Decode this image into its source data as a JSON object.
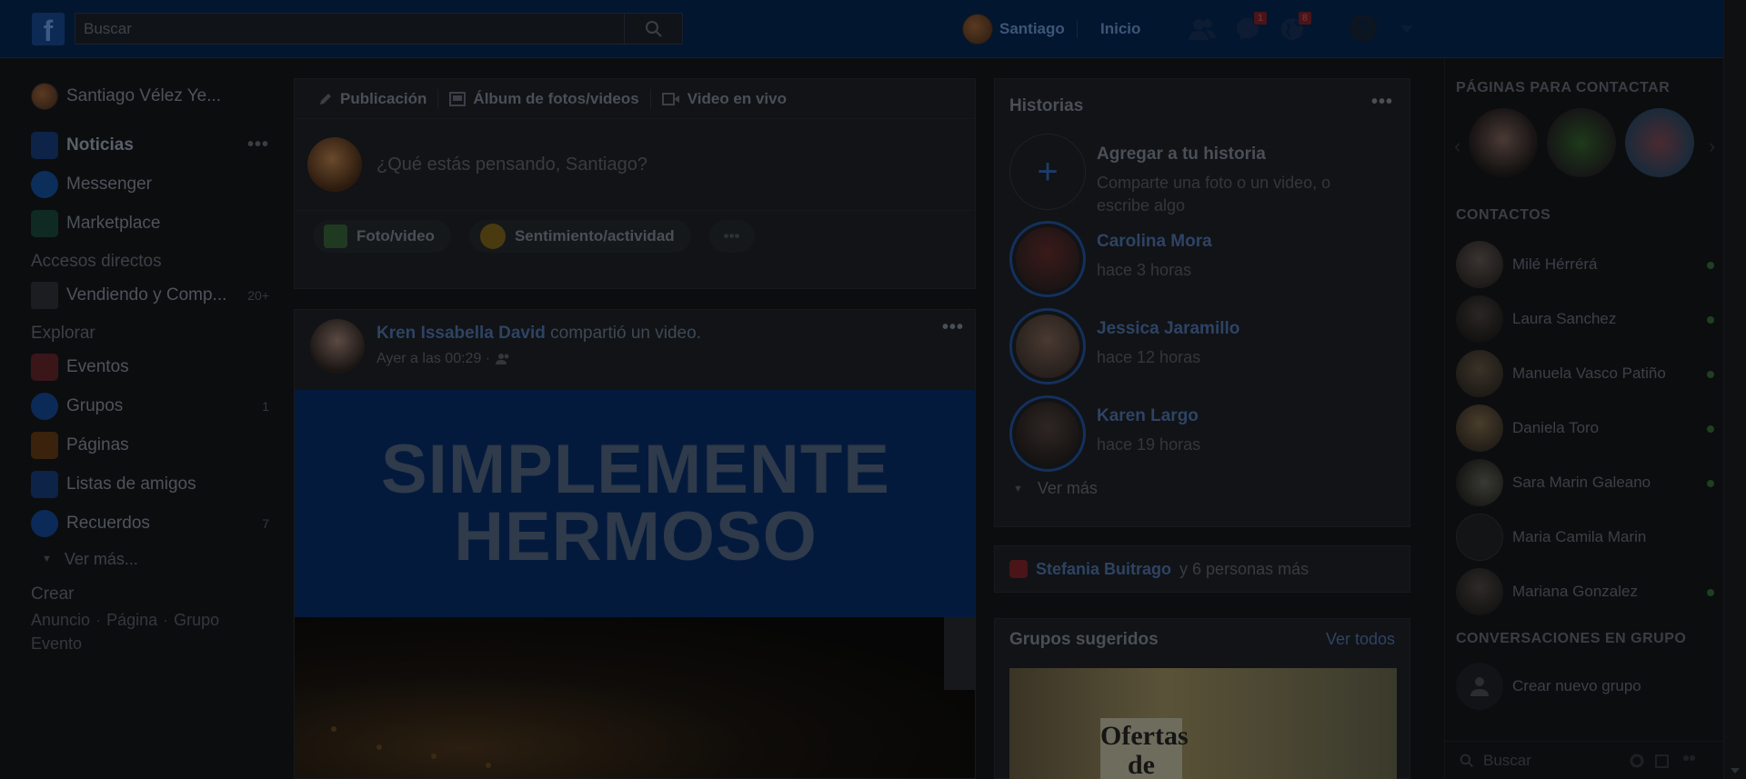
{
  "topbar": {
    "logo": "f",
    "search_placeholder": "Buscar",
    "user_name": "Santiago",
    "home": "Inicio",
    "messages_badge": "1",
    "notifications_badge": "8",
    "help": "?",
    "accent": "#02162f"
  },
  "sidebar": {
    "user": "Santiago Vélez Ye...",
    "news": "Noticias",
    "messenger": "Messenger",
    "marketplace": "Marketplace",
    "shortcuts_title": "Accesos directos",
    "shortcut_item": "Vendiendo y Comp...",
    "shortcut_count": "20+",
    "explore_title": "Explorar",
    "events": "Eventos",
    "groups": "Grupos",
    "groups_count": "1",
    "pages": "Páginas",
    "friend_lists": "Listas de amigos",
    "memories": "Recuerdos",
    "memories_count": "7",
    "see_more": "Ver más...",
    "create_title": "Crear",
    "create_ad": "Anuncio",
    "create_page": "Página",
    "create_group": "Grupo",
    "create_event": "Evento"
  },
  "composer": {
    "tab_post": "Publicación",
    "tab_album": "Álbum de fotos/videos",
    "tab_live": "Video en vivo",
    "placeholder": "¿Qué estás pensando, Santiago?",
    "photo_video": "Foto/video",
    "feeling": "Sentimiento/actividad",
    "more": "•••"
  },
  "post": {
    "author": "Kren Issabella David",
    "action": "compartió un video.",
    "time": "Ayer a las 00:29 ·",
    "banner_line1": "SIMPLEMENTE",
    "banner_line2": "HERMOSO",
    "menu": "•••"
  },
  "stories": {
    "title": "Historias",
    "menu": "•••",
    "add_title": "Agregar a tu historia",
    "add_sub": "Comparte una foto o un video, o escribe algo",
    "items": [
      {
        "name": "Carolina Mora",
        "time": "hace 3 horas"
      },
      {
        "name": "Jessica Jaramillo",
        "time": "hace 12 horas"
      },
      {
        "name": "Karen Largo",
        "time": "hace 19 horas"
      }
    ],
    "see_more": "Ver más"
  },
  "birthday": {
    "name": "Stefania Buitrago",
    "rest": "y 6 personas más"
  },
  "groups_suggest": {
    "title": "Grupos sugeridos",
    "see_all": "Ver todos",
    "image_text": "Ofertas de"
  },
  "right": {
    "pages_title": "PÁGINAS PARA CONTACTAR",
    "contacts_title": "CONTACTOS",
    "contacts": [
      {
        "name": "Milé Hérrérá"
      },
      {
        "name": "Laura Sanchez"
      },
      {
        "name": "Manuela Vasco Patiño"
      },
      {
        "name": "Daniela Toro"
      },
      {
        "name": "Sara Marin Galeano"
      },
      {
        "name": "Maria Camila Marin"
      },
      {
        "name": "Mariana Gonzalez"
      }
    ],
    "groups_title": "CONVERSACIONES EN GRUPO",
    "new_group": "Crear nuevo grupo",
    "search_placeholder": "Buscar"
  }
}
